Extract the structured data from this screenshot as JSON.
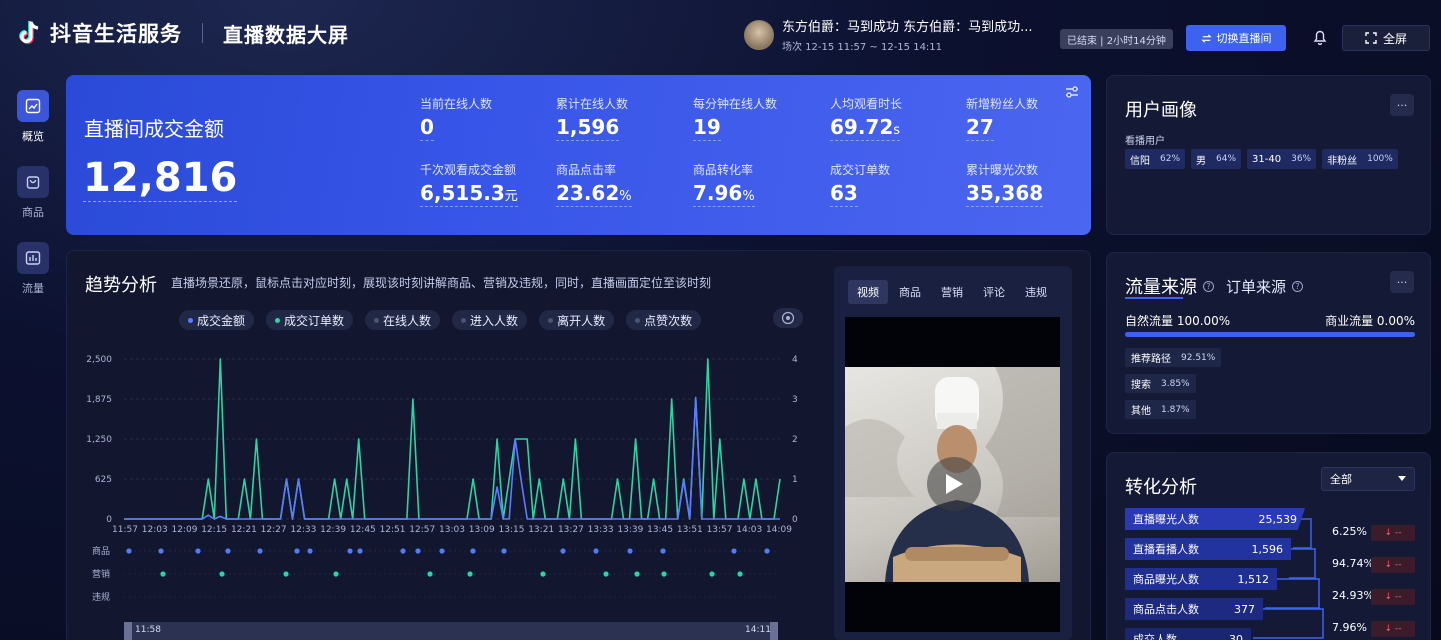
{
  "header": {
    "brand": "抖音生活服务",
    "title": "直播数据大屏",
    "host_name": "东方伯爵：马到成功 东方伯爵：马到成功...",
    "session_time": "场次 12-15 11:57 ~ 12-15 14:11",
    "status": "已结束 | 2小时14分钟",
    "switch_label": "切换直播间",
    "fullscreen_label": "全屏"
  },
  "sidebar": {
    "items": [
      {
        "label": "概览",
        "icon": "chart-icon",
        "active": true
      },
      {
        "label": "商品",
        "icon": "bag-icon",
        "active": false
      },
      {
        "label": "流量",
        "icon": "bars-icon",
        "active": false
      }
    ]
  },
  "hero": {
    "title": "直播间成交金额",
    "value": "12,816",
    "metrics": [
      {
        "label": "当前在线人数",
        "value": "0",
        "unit": ""
      },
      {
        "label": "累计在线人数",
        "value": "1,596",
        "unit": ""
      },
      {
        "label": "每分钟在线人数",
        "value": "19",
        "unit": ""
      },
      {
        "label": "人均观看时长",
        "value": "69.72",
        "unit": "s"
      },
      {
        "label": "新增粉丝人数",
        "value": "27",
        "unit": ""
      },
      {
        "label": "千次观看成交金额",
        "value": "6,515.3",
        "unit": "元"
      },
      {
        "label": "商品点击率",
        "value": "23.62",
        "unit": "%"
      },
      {
        "label": "商品转化率",
        "value": "7.96",
        "unit": "%"
      },
      {
        "label": "成交订单数",
        "value": "63",
        "unit": ""
      },
      {
        "label": "累计曝光次数",
        "value": "35,368",
        "unit": ""
      }
    ]
  },
  "user_portrait": {
    "title": "用户画像",
    "more": "···",
    "tag_group": "看播用户",
    "tags": [
      {
        "label": "信阳",
        "pct": "62%"
      },
      {
        "label": "男",
        "pct": "64%"
      },
      {
        "label": "31-40",
        "pct": "36%"
      },
      {
        "label": "非粉丝",
        "pct": "100%"
      }
    ]
  },
  "traffic": {
    "title": "流量来源",
    "subtitle": "订单来源",
    "more": "···",
    "natural": "自然流量 100.00%",
    "commercial": "商业流量 0.00%",
    "chips": [
      {
        "label": "推荐路径",
        "pct": "92.51%"
      },
      {
        "label": "搜索",
        "pct": "3.85%"
      },
      {
        "label": "其他",
        "pct": "1.87%"
      }
    ]
  },
  "conversion": {
    "title": "转化分析",
    "select": "全部",
    "rows": [
      {
        "label": "直播曝光人数",
        "value": "25,539"
      },
      {
        "label": "直播看播人数",
        "value": "1,596"
      },
      {
        "label": "商品曝光人数",
        "value": "1,512"
      },
      {
        "label": "商品点击人数",
        "value": "377"
      },
      {
        "label": "成交人数",
        "value": "30"
      }
    ],
    "rates": [
      "6.25%",
      "94.74%",
      "24.93%",
      "7.96%"
    ],
    "delta": "↓ --"
  },
  "trend": {
    "title": "趋势分析",
    "description": "直播场景还原，鼠标点击对应时刻，展现该时刻讲解商品、营销及违规，同时，直播画面定位至该时刻",
    "legend": [
      {
        "label": "成交金额",
        "color": "#5b7cff"
      },
      {
        "label": "成交订单数",
        "color": "#2bd4a4"
      },
      {
        "label": "在线人数",
        "color": "#4a5276"
      },
      {
        "label": "进入人数",
        "color": "#4a5276"
      },
      {
        "label": "离开人数",
        "color": "#4a5276"
      },
      {
        "label": "点赞次数",
        "color": "#4a5276"
      }
    ],
    "row_labels": [
      "商品",
      "营销",
      "违规"
    ],
    "range_start": "11:58",
    "range_end": "14:11"
  },
  "chart_data": {
    "type": "line",
    "x": [
      "11:57",
      "12:03",
      "12:09",
      "12:15",
      "12:21",
      "12:27",
      "12:33",
      "12:39",
      "12:45",
      "12:51",
      "12:57",
      "13:03",
      "13:09",
      "13:15",
      "13:21",
      "13:27",
      "13:33",
      "13:39",
      "13:45",
      "13:51",
      "13:57",
      "14:03",
      "14:09"
    ],
    "left_ticks": [
      "0",
      "625",
      "1,250",
      "1,875",
      "2,500"
    ],
    "right_ticks": [
      "0",
      "1",
      "2",
      "3",
      "4"
    ],
    "ylim": [
      0,
      2500
    ],
    "y2lim": [
      0,
      4
    ],
    "series": [
      {
        "name": "成交订单数",
        "color": "#2bd4a4",
        "values": [
          0,
          0,
          0,
          0,
          0,
          0,
          0,
          0,
          0,
          0,
          0,
          0,
          0,
          0,
          1,
          0,
          4,
          0,
          0,
          0,
          1,
          0,
          2,
          0,
          0,
          0,
          0,
          1,
          0,
          1,
          0,
          0,
          0,
          0,
          0,
          1,
          0,
          1,
          0,
          2,
          0,
          0,
          0,
          0,
          0,
          0,
          0,
          0,
          3,
          0,
          0,
          0,
          0,
          0,
          0,
          0,
          0,
          0,
          1,
          0,
          0,
          0,
          2,
          0,
          1,
          2,
          2,
          2,
          0,
          1,
          0,
          0,
          0,
          1,
          0,
          2,
          0,
          0,
          0,
          0,
          0,
          0,
          1,
          0,
          0,
          2,
          0,
          0,
          1,
          0,
          0,
          3,
          0,
          1,
          0,
          3,
          0,
          4,
          0,
          2,
          0,
          0,
          0,
          1,
          0,
          1,
          0,
          0,
          0,
          1
        ]
      },
      {
        "name": "成交金额",
        "color": "#5b7cff",
        "values": [
          0,
          0,
          0,
          0,
          0,
          0,
          0,
          0,
          0,
          0,
          0,
          0,
          0,
          0,
          60,
          0,
          40,
          0,
          0,
          0,
          0,
          0,
          0,
          0,
          0,
          0,
          0,
          620,
          0,
          620,
          0,
          0,
          0,
          0,
          0,
          0,
          0,
          0,
          0,
          0,
          0,
          0,
          0,
          0,
          0,
          0,
          0,
          0,
          0,
          0,
          0,
          0,
          0,
          0,
          0,
          0,
          0,
          0,
          0,
          0,
          0,
          0,
          500,
          0,
          0,
          1250,
          600,
          0,
          0,
          0,
          0,
          0,
          0,
          0,
          0,
          0,
          0,
          0,
          0,
          0,
          0,
          0,
          0,
          0,
          0,
          0,
          0,
          0,
          0,
          0,
          0,
          0,
          0,
          600,
          0,
          1900,
          0,
          0,
          0,
          0,
          0,
          0,
          0,
          0,
          0,
          0,
          0,
          0,
          0,
          0
        ]
      }
    ],
    "markers": {
      "商品": [
        129,
        161,
        198,
        228,
        260,
        297,
        310,
        350,
        360,
        403,
        418,
        442,
        473,
        504,
        563,
        596,
        630,
        663,
        734,
        767
      ],
      "营销": [
        163,
        222,
        286,
        336,
        430,
        470,
        543,
        606,
        637,
        664,
        712,
        740
      ]
    }
  }
}
